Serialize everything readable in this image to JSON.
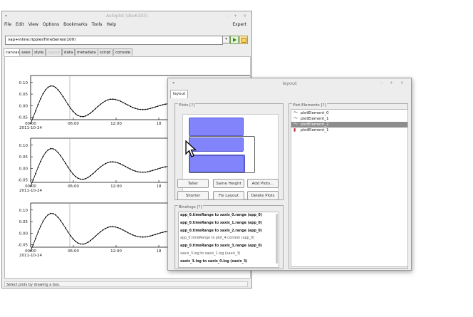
{
  "main_window": {
    "title": "Autoplot (dev6103)",
    "window_controls": "– + ×",
    "menus": [
      "File",
      "Edit",
      "View",
      "Options",
      "Bookmarks",
      "Tools",
      "Help"
    ],
    "expert_label": "Expert",
    "url_value": "vap+inline:ripplesTimeSeries(100)",
    "tabs": [
      {
        "label": "canvas",
        "state": "active"
      },
      {
        "label": "axes",
        "state": "normal"
      },
      {
        "label": "style",
        "state": "normal"
      },
      {
        "label": "layout",
        "state": "disabled"
      },
      {
        "label": "data",
        "state": "normal"
      },
      {
        "label": "metadata",
        "state": "normal"
      },
      {
        "label": "script",
        "state": "normal"
      },
      {
        "label": "console",
        "state": "normal"
      }
    ],
    "status_text": "Select plots by drawing a box.",
    "plots": [
      {
        "y_ticks": [
          "0.10",
          "0.05",
          "0.00",
          "-0.05"
        ],
        "x_ticks": [
          "00:00",
          "06:00",
          "12:00",
          "18"
        ],
        "x_date": "2011-10-24"
      },
      {
        "y_ticks": [
          "0.10",
          "0.05",
          "0.00",
          "-0.05"
        ],
        "x_ticks": [
          "00:00",
          "06:00",
          "12:00",
          "18"
        ],
        "x_date": "2011-10-24"
      },
      {
        "y_ticks": [
          "0.10",
          "0.05",
          "0.00",
          "-0.05"
        ],
        "x_ticks": [
          "00:00",
          "06:00",
          "12:00",
          "18"
        ],
        "x_date": "2011-10-24"
      }
    ]
  },
  "layout_window": {
    "title": "layout",
    "window_controls": "– + ×",
    "tab_label": "layout",
    "plots_label": "Plots [?]",
    "buttons": {
      "taller": "Taller",
      "same_height": "Same Height",
      "add_plots": "Add Plots...",
      "shorter": "Shorter",
      "fix_layout": "Fix Layout",
      "delete_plots": "Delete Plots"
    },
    "bindings_label": "Bindings [?]",
    "bindings": [
      "app_0.timeRange to xaxis_0.range (app_0)",
      "app_0.timeRange to xaxis_1.range (app_0)",
      "app_0.timeRange to xaxis_2.range (app_0)",
      "app_0.timeRange to plot_4.context (app_0)",
      "app_0.timeRange to xaxis_3.range (app_0)",
      "xaxis_3.log to xaxis_1.log (xaxis_3)",
      "xaxis_3.log to xaxis_0.log (xaxis_3)"
    ],
    "plot_elements_label": "Plot Elements [?]",
    "plot_elements": [
      {
        "label": "plotElement_0",
        "icon": "series-line-icon",
        "selected": false
      },
      {
        "label": "plotElement_1",
        "icon": "series-line-icon",
        "selected": false
      },
      {
        "label": "plotElement_2",
        "icon": "series-line-icon",
        "selected": true
      },
      {
        "label": "plotElement_1",
        "icon": "spectrogram-icon",
        "selected": false
      }
    ]
  },
  "colors": {
    "selection": "#6d6ffb",
    "selected_item": "#8d8d8d",
    "go_button": "#2e8f14"
  }
}
